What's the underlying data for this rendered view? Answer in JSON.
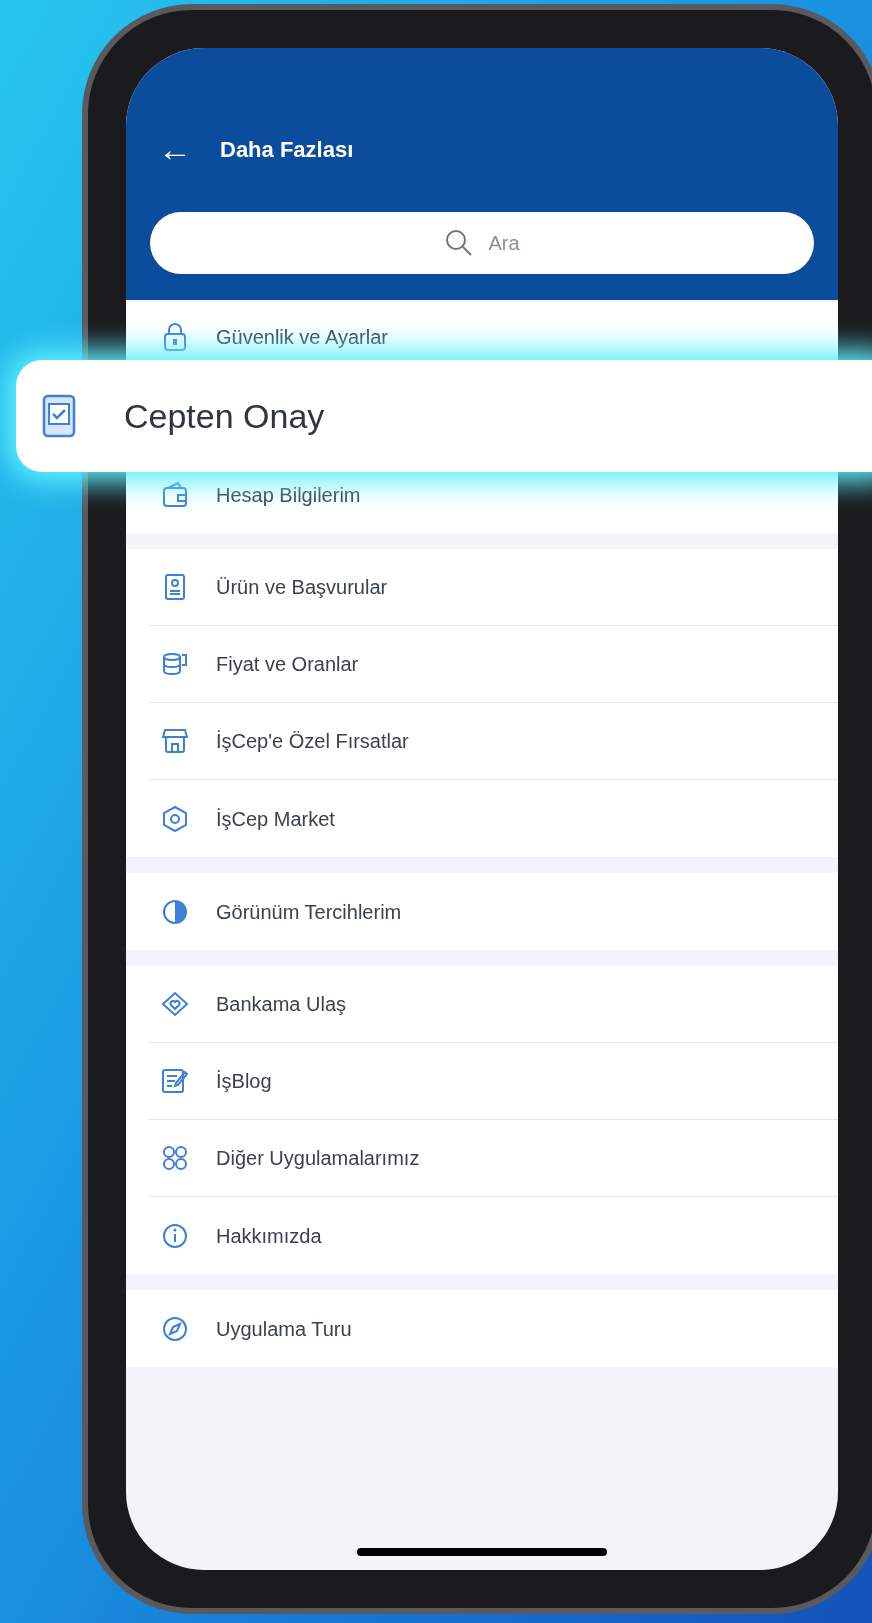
{
  "header": {
    "title": "Daha Fazlası",
    "back": "←"
  },
  "search": {
    "placeholder": "Ara"
  },
  "sections": [
    {
      "items": [
        {
          "label": "Güvenlik ve Ayarlar"
        },
        {
          "label": "Hesap Bilgilerim"
        }
      ]
    },
    {
      "items": [
        {
          "label": "Ürün ve Başvurular"
        },
        {
          "label": "Fiyat ve Oranlar"
        },
        {
          "label": "İşCep'e Özel Fırsatlar"
        },
        {
          "label": "İşCep Market"
        }
      ]
    },
    {
      "items": [
        {
          "label": "Görünüm Tercihlerim"
        }
      ]
    },
    {
      "items": [
        {
          "label": "Bankama Ulaş"
        },
        {
          "label": "İşBlog"
        },
        {
          "label": "Diğer Uygulamalarımız"
        },
        {
          "label": "Hakkımızda"
        }
      ]
    },
    {
      "items": [
        {
          "label": "Uygulama Turu"
        }
      ]
    }
  ],
  "highlight": {
    "label": "Cepten Onay"
  }
}
